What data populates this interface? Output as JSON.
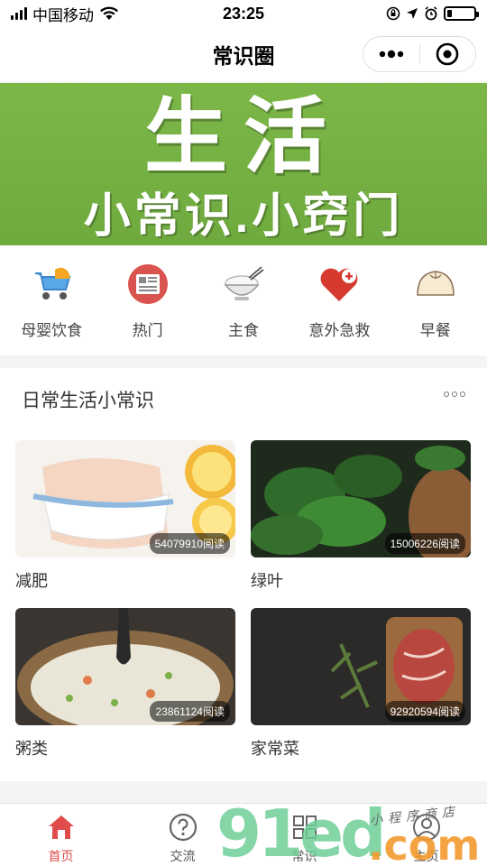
{
  "status": {
    "carrier": "中国移动",
    "time": "23:25",
    "battery_level": 0.18
  },
  "nav": {
    "title": "常识圈"
  },
  "banner": {
    "title": "生活",
    "subtitle": "小常识.小窍门"
  },
  "categories": [
    {
      "label": "母婴饮食",
      "icon": "baby-stroller-icon"
    },
    {
      "label": "热门",
      "icon": "newspaper-icon"
    },
    {
      "label": "主食",
      "icon": "rice-bowl-icon"
    },
    {
      "label": "意外急救",
      "icon": "first-aid-heart-icon"
    },
    {
      "label": "早餐",
      "icon": "steamed-bun-icon"
    }
  ],
  "section": {
    "title": "日常生活小常识",
    "cards": [
      {
        "title": "减肥",
        "reads": "54079910阅读"
      },
      {
        "title": "绿叶",
        "reads": "15006226阅读"
      },
      {
        "title": "粥类",
        "reads": "23861124阅读"
      },
      {
        "title": "家常菜",
        "reads": "92920594阅读"
      }
    ]
  },
  "tabbar": {
    "items": [
      {
        "label": "首页",
        "icon": "home-icon",
        "active": true
      },
      {
        "label": "交流",
        "icon": "question-circle-icon",
        "active": false
      },
      {
        "label": "常识",
        "icon": "grid-icon",
        "active": false
      },
      {
        "label": "主页",
        "icon": "user-icon",
        "active": false
      }
    ]
  },
  "watermark": {
    "brand": "91ed",
    "domain": ".com",
    "tagline": "小程序商店"
  },
  "colors": {
    "accent": "#e04b4b",
    "banner_green": "#72ad42"
  }
}
